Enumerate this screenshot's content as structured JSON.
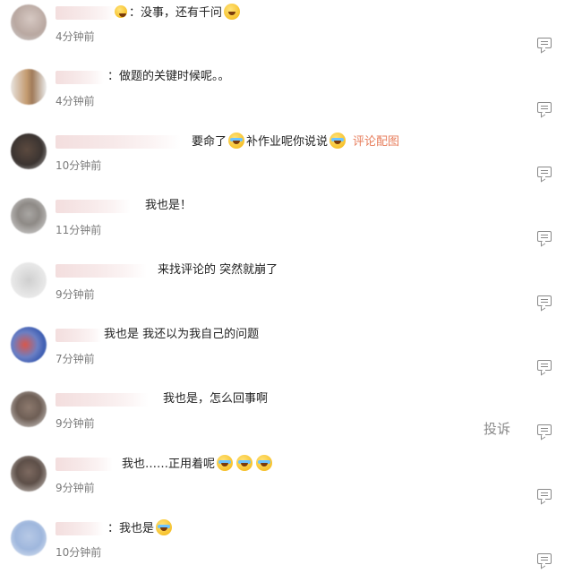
{
  "comments": [
    {
      "text": "：没事，还有千问",
      "emoji_after": true,
      "time": "4分钟前"
    },
    {
      "text": "：做题的关键时候呢。。",
      "time": "4分钟前"
    },
    {
      "text": "要命了",
      "text2": "补作业呢你说说",
      "link": "评论配图",
      "time": "10分钟前"
    },
    {
      "text": "我也是！",
      "time": "11分钟前"
    },
    {
      "text": "来找评论的 突然就崩了",
      "time": "9分钟前"
    },
    {
      "text": "我也是 我还以为我自己的问题",
      "time": "7分钟前"
    },
    {
      "text": "我也是，怎么回事啊",
      "time": "9分钟前",
      "report": "投诉"
    },
    {
      "text": "我也……正用着呢",
      "time": "9分钟前"
    },
    {
      "text": "：我也是",
      "time": "10分钟前"
    }
  ],
  "icons": {
    "reply": "comment-reply-icon",
    "emoji": "emoji-icon"
  }
}
